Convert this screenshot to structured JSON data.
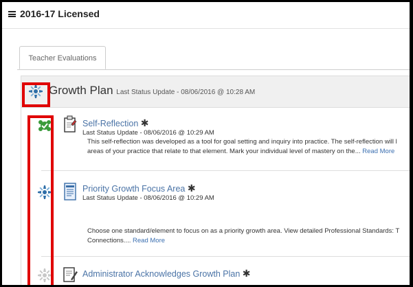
{
  "header": {
    "title": "2016-17 Licensed"
  },
  "tabs": [
    {
      "label": "Teacher Evaluations"
    }
  ],
  "plan": {
    "title": "Growth Plan",
    "status": "Last Status Update - 08/06/2016 @ 10:28 AM"
  },
  "items": [
    {
      "title": "Self-Reflection",
      "required_mark": "✱",
      "status": "Last Status Update - 08/06/2016 @ 10:29 AM",
      "desc_line1": "This self-reflection was developed as a tool for goal setting and inquiry into practice. The self-reflection will l",
      "desc_line2": "areas of your practice that relate to that element. Mark your individual level of mastery on the...",
      "read_more": "Read More",
      "status_icon": "completed-check-icon",
      "doc_icon": "document-icon"
    },
    {
      "title": "Priority Growth Focus Area",
      "required_mark": "✱",
      "status": "Last Status Update - 08/06/2016 @ 10:29 AM",
      "desc_line1": "Choose one standard/element to focus on as a priority growth area. View detailed Professional Standards: T",
      "desc_line2": "Connections....",
      "read_more": "Read More",
      "status_icon": "in-progress-icon",
      "doc_icon": "form-icon"
    },
    {
      "title": "Administrator Acknowledges Growth Plan",
      "required_mark": "✱",
      "status_icon": "not-started-icon",
      "doc_icon": "sign-document-icon"
    }
  ],
  "colors": {
    "link": "#4a73a6",
    "highlight": "#e00000",
    "progress": "#2f6fa8",
    "complete": "#3a9a3a"
  }
}
